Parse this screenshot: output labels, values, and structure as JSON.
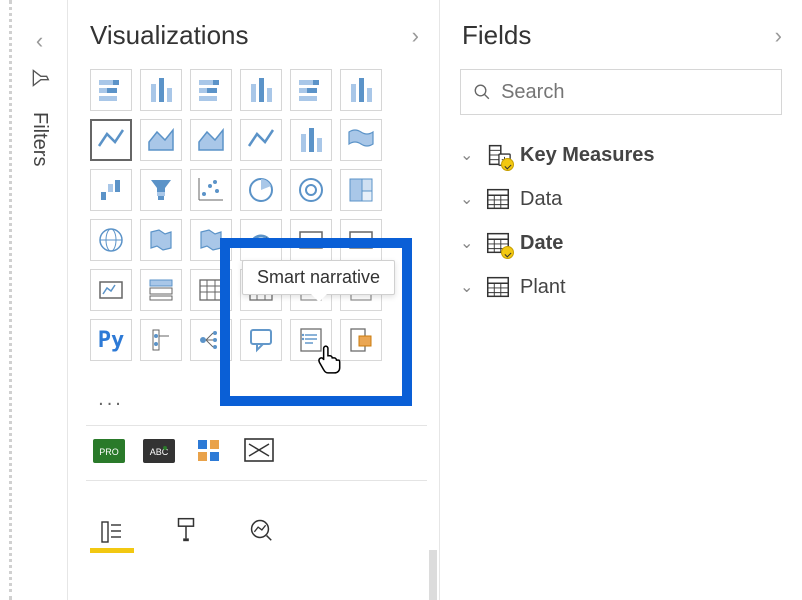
{
  "filters": {
    "label": "Filters"
  },
  "visualizations": {
    "title": "Visualizations",
    "tooltip": "Smart narrative",
    "icons": [
      "stacked-bar",
      "stacked-column",
      "clustered-bar",
      "clustered-column",
      "100-stacked-bar",
      "100-stacked-column",
      "line",
      "area",
      "stacked-area",
      "line-stacked-column",
      "line-clustered-column",
      "ribbon",
      "waterfall",
      "funnel",
      "scatter",
      "pie",
      "donut",
      "treemap",
      "map",
      "filled-map",
      "shape-map",
      "gauge",
      "card",
      "multi-row-card",
      "kpi",
      "slicer",
      "table",
      "matrix",
      "r-script",
      "python-script",
      "python",
      "key-influencers",
      "decomposition-tree",
      "qa",
      "smart-narrative",
      "paginated-report"
    ],
    "ellipsis": "...",
    "bottom_icons": [
      "get-more-visuals",
      "text-box",
      "grid",
      "image-placeholder"
    ]
  },
  "fields": {
    "title": "Fields",
    "search_placeholder": "Search",
    "items": [
      {
        "label": "Key Measures",
        "icon": "calc-table",
        "bold": true,
        "badge": true
      },
      {
        "label": "Data",
        "icon": "table",
        "bold": false,
        "badge": false
      },
      {
        "label": "Date",
        "icon": "table",
        "bold": true,
        "badge": true
      },
      {
        "label": "Plant",
        "icon": "table",
        "bold": false,
        "badge": false
      }
    ]
  },
  "colors": {
    "accent_blue": "#2d7ad6",
    "accent_yellow": "#f2c811",
    "highlight": "#0a5fd6"
  }
}
